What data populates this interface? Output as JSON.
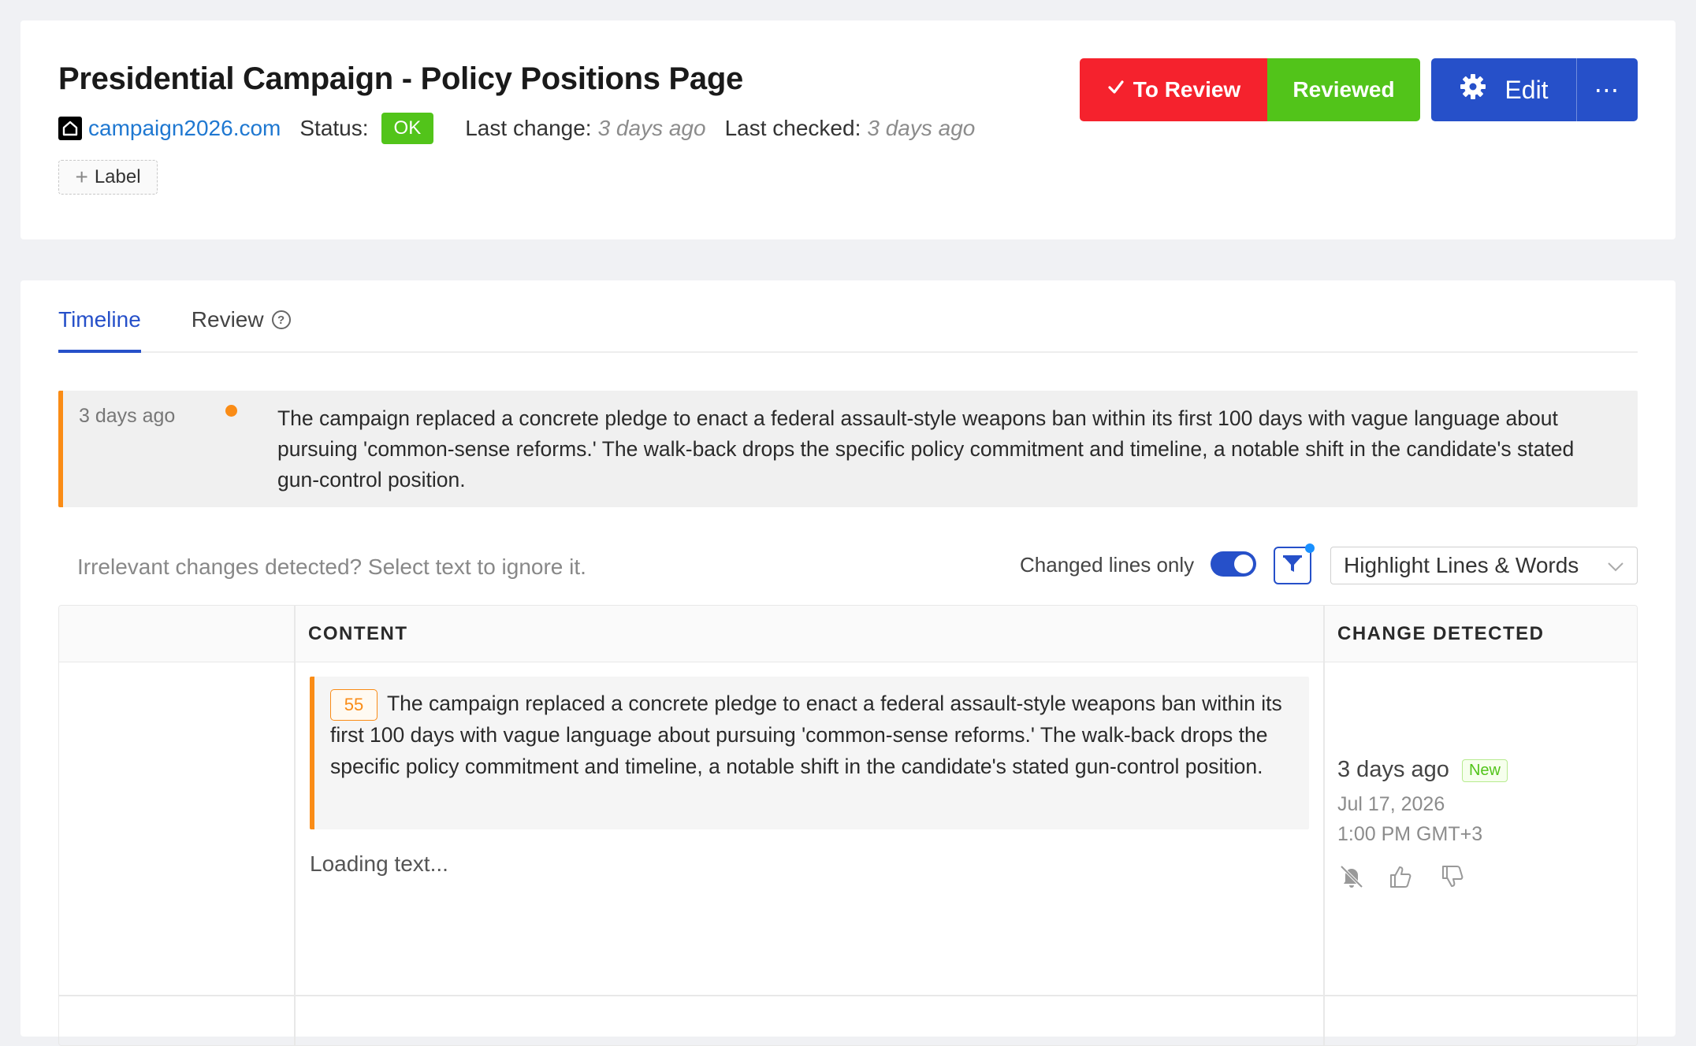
{
  "header": {
    "title": "Presidential Campaign - Policy Positions Page",
    "site": "campaign2026.com",
    "status_label": "Status:",
    "status_value": "OK",
    "last_change_label": "Last change:",
    "last_change_value": "3 days ago",
    "last_checked_label": "Last checked:",
    "last_checked_value": "3 days ago",
    "label_button": "Label",
    "to_review_button": "To Review",
    "reviewed_button": "Reviewed",
    "edit_button": "Edit",
    "more_button": "⋯"
  },
  "tabs": [
    {
      "label": "Timeline",
      "active": true
    },
    {
      "label": "Review",
      "active": false
    }
  ],
  "summary": {
    "time": "3 days ago",
    "text": "The campaign replaced a concrete pledge to enact a federal assault-style weapons ban within its first 100 days with vague language about pursuing 'common-sense reforms.' The walk-back drops the specific policy commitment and timeline, a notable shift in the candidate's stated gun-control position."
  },
  "toolbar": {
    "hint": "Irrelevant changes detected? Select text to ignore it.",
    "changed_lines_label": "Changed lines only",
    "changed_lines_on": true,
    "highlight_select": "Highlight Lines & Words"
  },
  "table": {
    "col_content": "CONTENT",
    "col_change": "CHANGE DETECTED",
    "rows": [
      {
        "line_number": "55",
        "text": "The campaign replaced a concrete pledge to enact a federal assault-style weapons ban within its first 100 days with vague language about pursuing 'common-sense reforms.' The walk-back drops the specific policy commitment and timeline, a notable shift in the candidate's stated gun-control position.",
        "loading": "Loading text...",
        "change_time": "3 days ago",
        "badge": "New",
        "change_date": "Jul 17, 2026",
        "change_clock": "1:00 PM GMT+3"
      }
    ]
  },
  "colors": {
    "primary": "#2650c9",
    "danger": "#f5222d",
    "success": "#52c41a",
    "warning": "#fa8c16",
    "link": "#1f78d1"
  }
}
